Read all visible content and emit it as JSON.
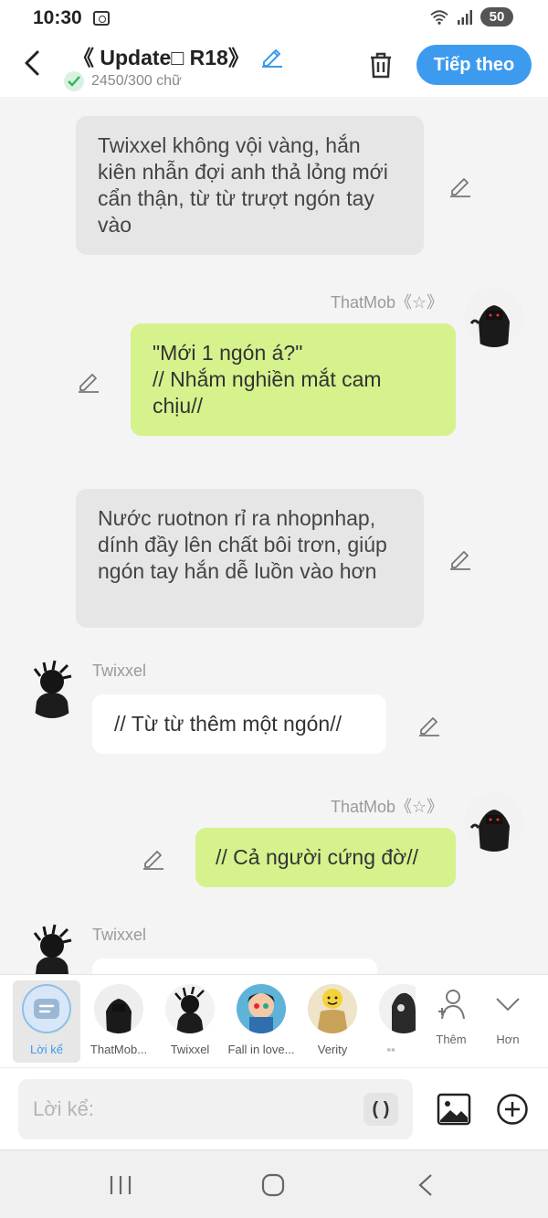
{
  "status_bar": {
    "time": "10:30",
    "battery": "50"
  },
  "header": {
    "title": "《 Update□ R18》",
    "word_count": "2450/300 chữ",
    "next_label": "Tiếp theo"
  },
  "messages": [
    {
      "type": "narration",
      "text": "Twixxel không vội vàng, hắn kiên nhẫn đợi anh thả lỏng mới cẩn thận, từ từ trượt ngón tay vào"
    },
    {
      "type": "right",
      "sender": "ThatMob《☆》",
      "text": "\"Mới 1 ngón á?\"\n// Nhắm nghiền mắt cam chịu//"
    },
    {
      "type": "narration",
      "text": "Nước ruotnon rỉ ra nhopnhap, dính đầy lên chất bôi trơn, giúp ngón tay hắn dễ luồn vào hơn"
    },
    {
      "type": "left",
      "sender": "Twixxel",
      "text": "// Từ từ thêm một ngón//"
    },
    {
      "type": "right",
      "sender": "ThatMob《☆》",
      "text": "// Cả người cứng đờ//"
    },
    {
      "type": "left",
      "sender": "Twixxel",
      "text": ""
    }
  ],
  "characters": [
    {
      "label": "Lời kể",
      "active": true
    },
    {
      "label": "ThatMob..."
    },
    {
      "label": "Twixxel"
    },
    {
      "label": "Fall in love..."
    },
    {
      "label": "Verity"
    },
    {
      "label": "▪▪"
    }
  ],
  "tools": {
    "add_label": "Thêm",
    "more_label": "Hơn"
  },
  "input": {
    "placeholder": "Lời kể:",
    "paren_label": "( )"
  },
  "colors": {
    "accent": "#3d9bef",
    "right_bubble": "#d5f28c",
    "narration_bubble": "#e6e6e6"
  }
}
